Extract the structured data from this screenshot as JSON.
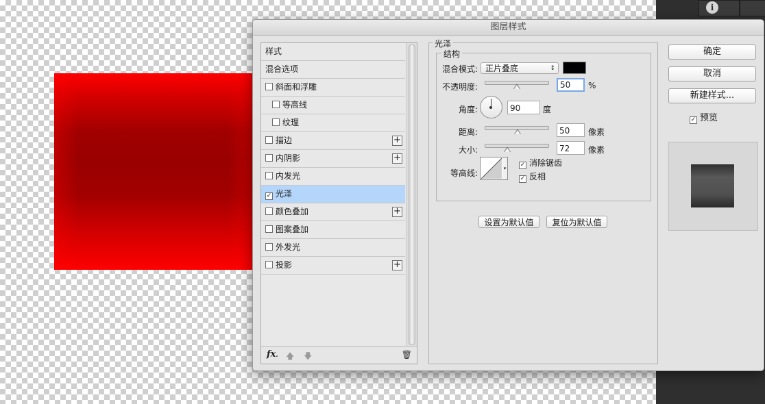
{
  "dialog": {
    "title": "图层样式"
  },
  "styles_list": [
    {
      "label": "样式",
      "checkbox": false,
      "checked": false,
      "indent": false,
      "plus": false,
      "selected": false
    },
    {
      "label": "混合选项",
      "checkbox": false,
      "checked": false,
      "indent": false,
      "plus": false,
      "selected": false
    },
    {
      "label": "斜面和浮雕",
      "checkbox": true,
      "checked": false,
      "indent": false,
      "plus": false,
      "selected": false
    },
    {
      "label": "等高线",
      "checkbox": true,
      "checked": false,
      "indent": true,
      "plus": false,
      "selected": false
    },
    {
      "label": "纹理",
      "checkbox": true,
      "checked": false,
      "indent": true,
      "plus": false,
      "selected": false
    },
    {
      "label": "描边",
      "checkbox": true,
      "checked": false,
      "indent": false,
      "plus": true,
      "selected": false
    },
    {
      "label": "内阴影",
      "checkbox": true,
      "checked": false,
      "indent": false,
      "plus": true,
      "selected": false
    },
    {
      "label": "内发光",
      "checkbox": true,
      "checked": false,
      "indent": false,
      "plus": false,
      "selected": false
    },
    {
      "label": "光泽",
      "checkbox": true,
      "checked": true,
      "indent": false,
      "plus": false,
      "selected": true
    },
    {
      "label": "颜色叠加",
      "checkbox": true,
      "checked": false,
      "indent": false,
      "plus": true,
      "selected": false
    },
    {
      "label": "图案叠加",
      "checkbox": true,
      "checked": false,
      "indent": false,
      "plus": false,
      "selected": false
    },
    {
      "label": "外发光",
      "checkbox": true,
      "checked": false,
      "indent": false,
      "plus": false,
      "selected": false
    },
    {
      "label": "投影",
      "checkbox": true,
      "checked": false,
      "indent": false,
      "plus": true,
      "selected": false
    }
  ],
  "footer": {
    "fx_label": "fx",
    "fx_suffix": "."
  },
  "satin": {
    "section_title": "光泽",
    "structure_title": "结构",
    "blend_mode_label": "混合模式:",
    "blend_mode_value": "正片叠底",
    "blend_color": "#000000",
    "opacity_label": "不透明度:",
    "opacity_value": "50",
    "opacity_unit": "%",
    "angle_label": "角度:",
    "angle_value": "90",
    "angle_unit": "度",
    "distance_label": "距离:",
    "distance_value": "50",
    "distance_unit": "像素",
    "size_label": "大小:",
    "size_value": "72",
    "size_unit": "像素",
    "contour_label": "等高线:",
    "anti_alias_label": "消除锯齿",
    "anti_alias_checked": true,
    "invert_label": "反相",
    "invert_checked": true,
    "make_default_label": "设置为默认值",
    "reset_default_label": "复位为默认值"
  },
  "actions": {
    "ok_label": "确定",
    "cancel_label": "取消",
    "new_style_label": "新建样式...",
    "preview_label": "预览",
    "preview_checked": true
  },
  "colors": {
    "canvas_red": "#ff0000",
    "selection": "#b4d6fb",
    "preview_swatch": "#3c3c3c"
  }
}
